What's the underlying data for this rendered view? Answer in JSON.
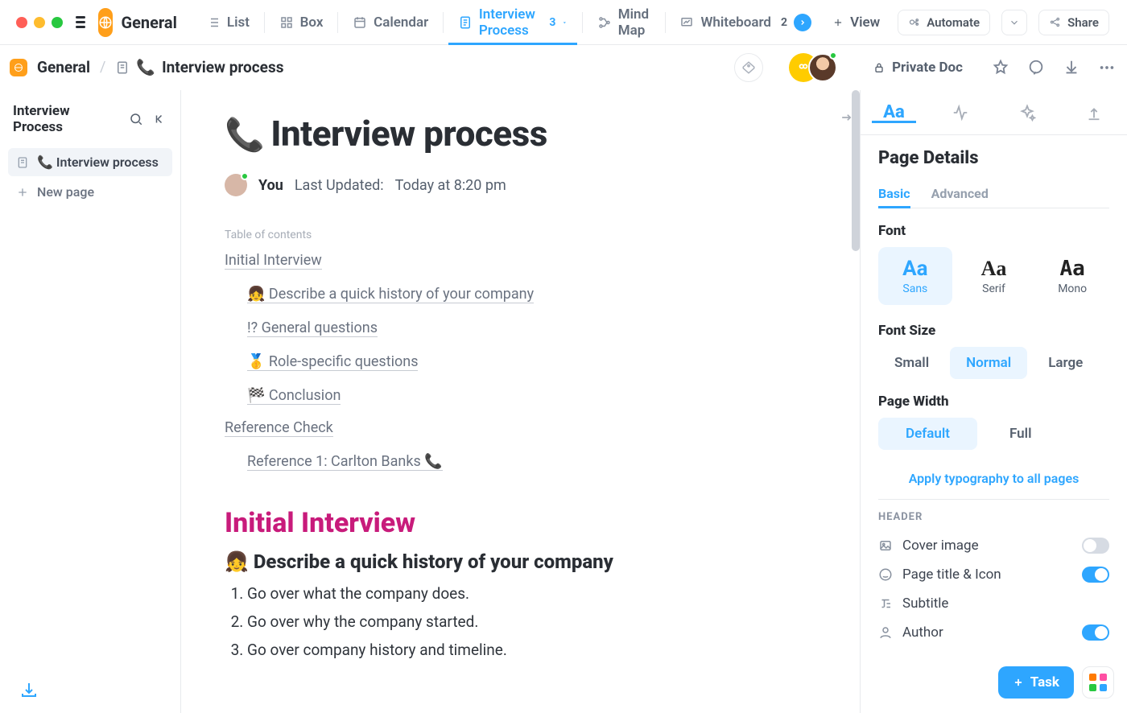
{
  "workspace": {
    "name": "General"
  },
  "views": [
    {
      "icon": "list",
      "label": "List"
    },
    {
      "icon": "box",
      "label": "Box"
    },
    {
      "icon": "calendar",
      "label": "Calendar"
    },
    {
      "icon": "doc",
      "label": "Interview Process",
      "count": "3",
      "active": true,
      "caret": true
    },
    {
      "icon": "mindmap",
      "label": "Mind Map"
    },
    {
      "icon": "whiteboard",
      "label": "Whiteboard",
      "count": "2",
      "arrow": true
    }
  ],
  "view_btn": "View",
  "automate_btn": "Automate",
  "share_btn": "Share",
  "breadcrumb": {
    "root": "General",
    "doc_icon": "📞",
    "doc_title": "Interview process",
    "privacy": "Private Doc"
  },
  "left": {
    "title": "Interview Process",
    "items": [
      {
        "label": "📞 Interview process",
        "active": true
      },
      {
        "label": "New page",
        "icon": "plus"
      }
    ]
  },
  "doc": {
    "title_emoji": "📞",
    "title": "Interview process",
    "author": "You",
    "updated_label": "Last Updated:",
    "updated_value": "Today at 8:20 pm",
    "toc_header": "Table of contents",
    "toc": [
      {
        "lvl": 1,
        "text": "Initial Interview"
      },
      {
        "lvl": 2,
        "text": "👧 Describe a quick history of your company"
      },
      {
        "lvl": 2,
        "text": "!? General questions"
      },
      {
        "lvl": 2,
        "text": "🥇 Role-specific questions"
      },
      {
        "lvl": 2,
        "text": "🏁 Conclusion"
      },
      {
        "lvl": 1,
        "text": "Reference Check"
      },
      {
        "lvl": 2,
        "text": "Reference 1: Carlton Banks 📞"
      }
    ],
    "h_initial": "Initial Interview",
    "h_sub": "👧 Describe a quick history of your company",
    "ol": [
      "Go over what the company does.",
      "Go over why the company started.",
      "Go over company history and timeline."
    ]
  },
  "right": {
    "title": "Page Details",
    "tabs": {
      "basic": "Basic",
      "advanced": "Advanced"
    },
    "font_h": "Font",
    "fonts": {
      "sans": "Sans",
      "serif": "Serif",
      "mono": "Mono",
      "Aa": "Aa"
    },
    "fontsize_h": "Font Size",
    "sizes": {
      "small": "Small",
      "normal": "Normal",
      "large": "Large"
    },
    "pagewidth_h": "Page Width",
    "widths": {
      "default": "Default",
      "full": "Full"
    },
    "apply": "Apply typography to all pages",
    "header_h": "HEADER",
    "toggles": {
      "cover": "Cover image",
      "title": "Page title & Icon",
      "subtitle": "Subtitle",
      "author": "Author"
    }
  },
  "task_btn": "Task"
}
